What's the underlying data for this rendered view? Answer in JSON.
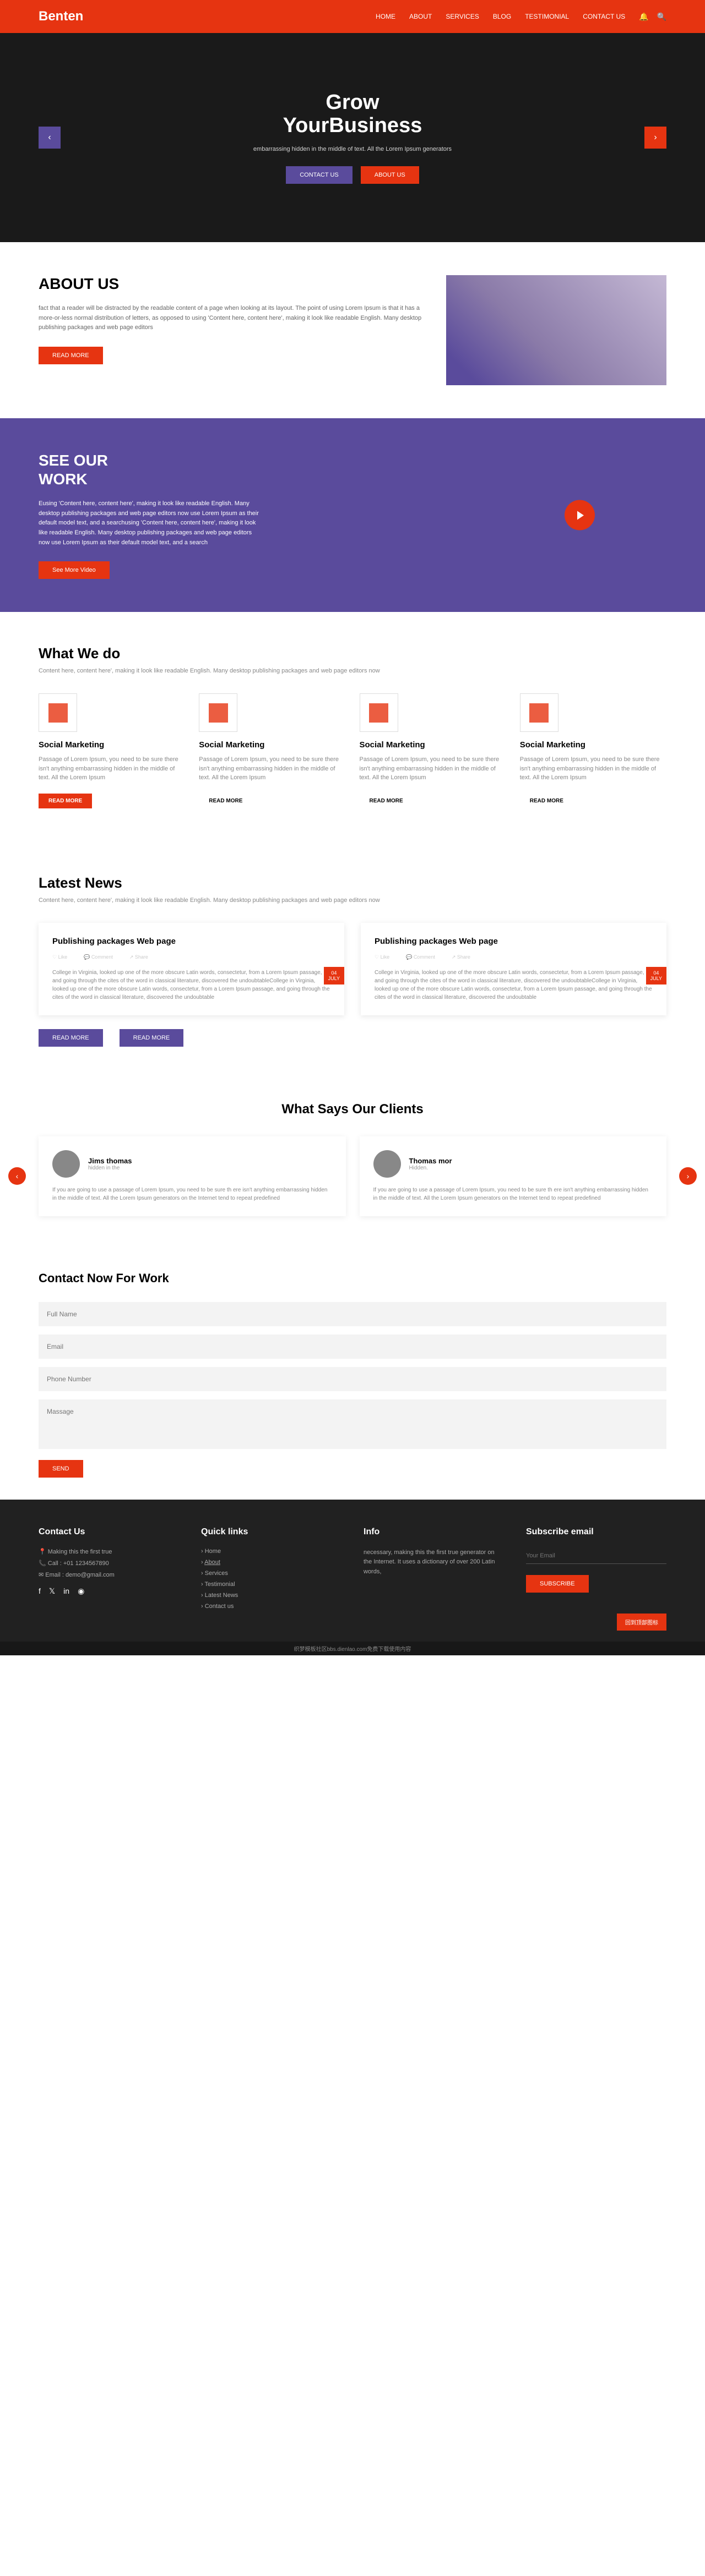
{
  "brand": "Benten",
  "nav": {
    "items": [
      "HOME",
      "ABOUT",
      "SERVICES",
      "BLOG",
      "TESTIMONIAL",
      "CONTACT US"
    ]
  },
  "hero": {
    "title1": "Grow",
    "title2": "YourBusiness",
    "sub": "embarrassing hidden in the middle of text. All the Lorem Ipsum generators",
    "btn1": "CONTACT US",
    "btn2": "ABOUT US"
  },
  "about": {
    "title": "ABOUT US",
    "text": "fact that a reader will be distracted by the readable content of a page when looking at its layout. The point of using Lorem Ipsum is that it has a more-or-less normal distribution of letters, as opposed to using 'Content here, content here', making it look like readable English. Many desktop publishing packages and web page editors",
    "btn": "READ MORE"
  },
  "work": {
    "title1": "SEE OUR",
    "title2": "WORK",
    "text": "Eusing 'Content here, content here', making it look like readable English. Many desktop publishing packages and web page editors now use Lorem Ipsum as their default model text, and a searchusing 'Content here, content here', making it look like readable English. Many desktop publishing packages and web page editors now use Lorem Ipsum as their default model text, and a search",
    "btn": "See More Video"
  },
  "whatwedo": {
    "title": "What We do",
    "sub": "Content here, content here', making it look like readable English. Many desktop publishing packages and web page editors now",
    "services": [
      {
        "title": "Social Marketing",
        "text": "Passage of Lorem Ipsum, you need to be sure there isn't anything embarrassing hidden in the middle of text. All the Lorem Ipsum",
        "btn": "READ MORE"
      },
      {
        "title": "Social Marketing",
        "text": "Passage of Lorem Ipsum, you need to be sure there isn't anything embarrassing hidden in the middle of text. All the Lorem Ipsum",
        "btn": "READ MORE"
      },
      {
        "title": "Social Marketing",
        "text": "Passage of Lorem Ipsum, you need to be sure there isn't anything embarrassing hidden in the middle of text. All the Lorem Ipsum",
        "btn": "READ MORE"
      },
      {
        "title": "Social Marketing",
        "text": "Passage of Lorem Ipsum, you need to be sure there isn't anything embarrassing hidden in the middle of text. All the Lorem Ipsum",
        "btn": "READ MORE"
      }
    ]
  },
  "news": {
    "title": "Latest News",
    "sub": "Content here, content here', making it look like readable English. Many desktop publishing packages and web page editors now",
    "date": {
      "day": "04",
      "month": "JULY"
    },
    "social": {
      "like": "Like",
      "comment": "Comment",
      "share": "Share"
    },
    "cards": [
      {
        "title": "Publishing packages Web page",
        "text": "College in Virginia, looked up one of the more obscure Latin words, consectetur, from a Lorem Ipsum passage, and going through the cites of the word in classical literature, discovered the undoubtableCollege in Virginia, looked up one of the more obscure Latin words, consectetur, from a Lorem Ipsum passage, and going through the cites of the word in classical literature, discovered the undoubtable"
      },
      {
        "title": "Publishing packages Web page",
        "text": "College in Virginia, looked up one of the more obscure Latin words, consectetur, from a Lorem Ipsum passage, and going through the cites of the word in classical literature, discovered the undoubtableCollege in Virginia, looked up one of the more obscure Latin words, consectetur, from a Lorem Ipsum passage, and going through the cites of the word in classical literature, discovered the undoubtable"
      }
    ],
    "btn": "READ MORE"
  },
  "clients": {
    "title": "What Says Our Clients",
    "items": [
      {
        "name": "Jims thomas",
        "role": "hidden in the",
        "text": "If you are going to use a passage of Lorem Ipsum, you need to be sure th ere isn't anything embarrassing hidden in the middle of text. All the Lorem Ipsum generators on the Internet tend to repeat predefined"
      },
      {
        "name": "Thomas mor",
        "role": "Hidden.",
        "text": "If you are going to use a passage of Lorem Ipsum, you need to be sure th ere isn't anything embarrassing hidden in the middle of text. All the Lorem Ipsum generators on the Internet tend to repeat predefined"
      }
    ]
  },
  "contact": {
    "title": "Contact Now For Work",
    "ph": {
      "name": "Full Name",
      "email": "Email",
      "phone": "Phone Number",
      "msg": "Massage"
    },
    "btn": "SEND"
  },
  "footer": {
    "c1": {
      "title": "Contact Us",
      "l1": "Making this the first true",
      "l2": "Call : +01 1234567890",
      "l3": "Email : demo@gmail.com"
    },
    "c2": {
      "title": "Quick links",
      "items": [
        "Home",
        "About",
        "Services",
        "Testimonial",
        "Latest News",
        "Contact us"
      ]
    },
    "c3": {
      "title": "Info",
      "text": "necessary, making this the first true generator on the Internet. It uses a dictionary of over 200 Latin words,"
    },
    "c4": {
      "title": "Subscribe email",
      "ph": "Your Email",
      "btn": "SUBSCRIBE"
    },
    "scroll": "回到顶部图标"
  },
  "watermark": "织梦模板社区bbs.dienlao.com免费下载使用内容"
}
